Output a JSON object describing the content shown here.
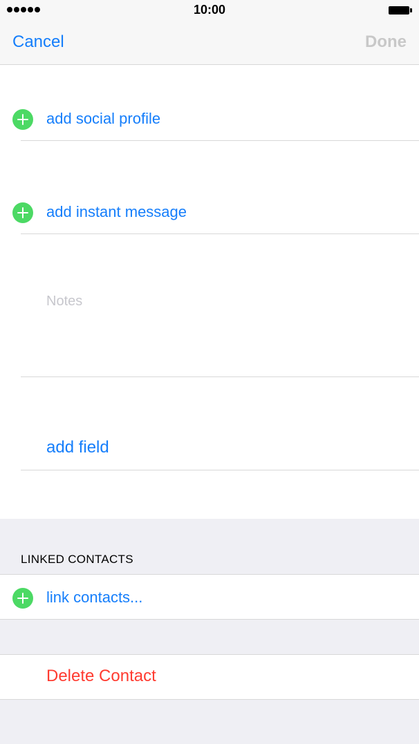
{
  "status_bar": {
    "time": "10:00"
  },
  "nav": {
    "cancel_label": "Cancel",
    "done_label": "Done"
  },
  "rows": {
    "social_profile": "add social profile",
    "instant_message": "add instant message",
    "notes_placeholder": "Notes",
    "add_field": "add field"
  },
  "linked_contacts": {
    "section_header": "LINKED CONTACTS",
    "link_label": "link contacts..."
  },
  "delete_label": "Delete Contact",
  "colors": {
    "accent": "#157efb",
    "add_green": "#4cd964",
    "delete_red": "#ff3b30",
    "group_bg": "#efeff4"
  }
}
